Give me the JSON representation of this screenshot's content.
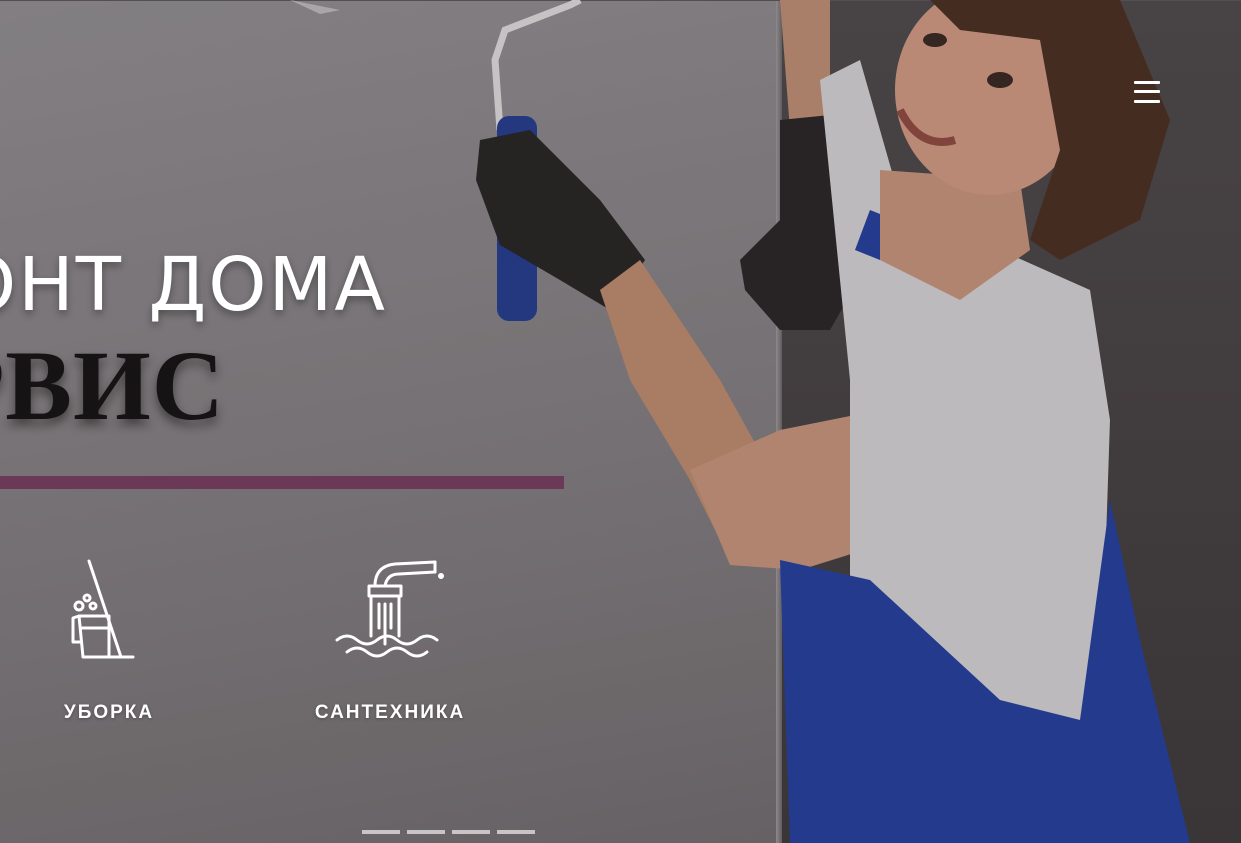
{
  "hero": {
    "heading_line1": "ОНТ ДОМА",
    "heading_line2": "РВИС"
  },
  "menu": {
    "icon": "hamburger-menu-icon"
  },
  "services": [
    {
      "label": "УБОРКА",
      "icon": "broom-bucket-icon"
    },
    {
      "label": "САНТЕХНИКА",
      "icon": "faucet-water-icon"
    }
  ],
  "slider": {
    "slide_count": 4
  },
  "colors": {
    "accent": "#6b3857",
    "heading_light": "#ffffff",
    "heading_dark": "#161314",
    "overlay": "#6e686b"
  }
}
